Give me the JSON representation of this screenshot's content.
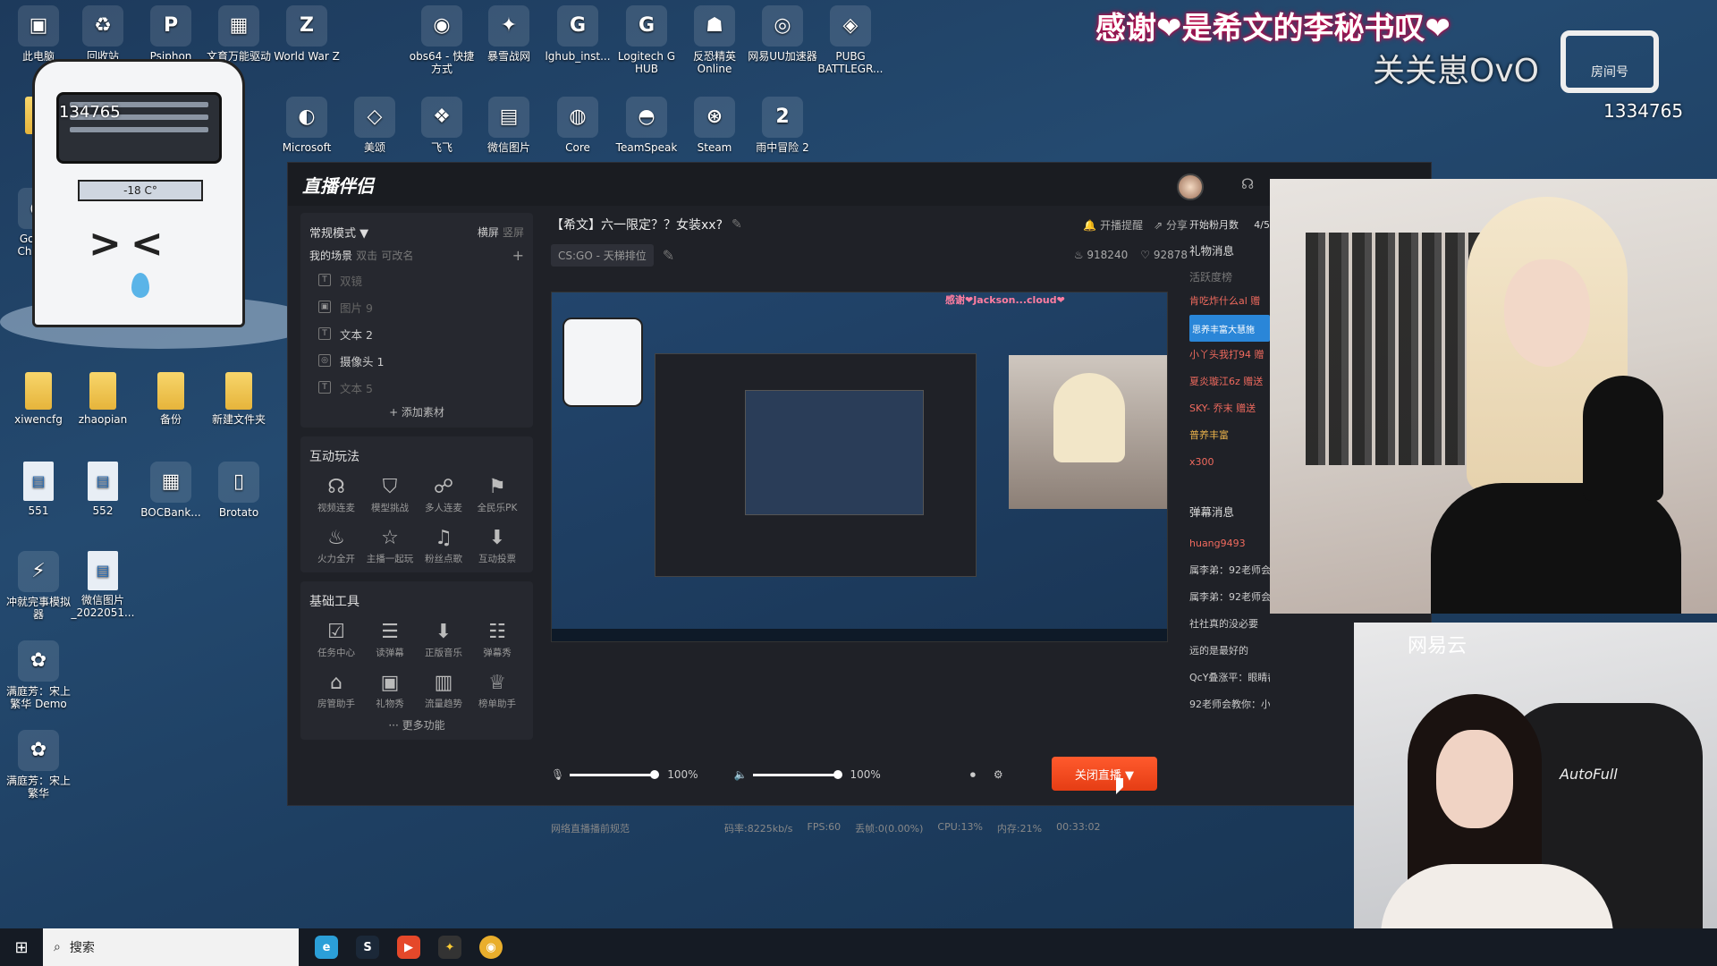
{
  "desktop": {
    "icons_row1": [
      {
        "label": "此电脑",
        "glyph": "▣"
      },
      {
        "label": "回收站",
        "glyph": "♻"
      },
      {
        "label": "Psiphon",
        "glyph": "P"
      },
      {
        "label": "文育万能驱动",
        "glyph": "▦"
      },
      {
        "label": "World War Z",
        "glyph": "Z"
      },
      {
        "label": "obs64 - 快捷方式",
        "glyph": "◉"
      },
      {
        "label": "暴雪战网",
        "glyph": "✦"
      },
      {
        "label": "lghub_inst...",
        "glyph": "G"
      },
      {
        "label": "Logitech G HUB",
        "glyph": "G"
      },
      {
        "label": "反恐精英 Online",
        "glyph": "☗"
      },
      {
        "label": "网易UU加速器",
        "glyph": "◎"
      },
      {
        "label": "PUBG BATTLEGR...",
        "glyph": "◈"
      }
    ],
    "icons_row2": [
      {
        "label": "调",
        "glyph": "▮"
      },
      {
        "label": "Microsoft",
        "glyph": "◐"
      },
      {
        "label": "美颂",
        "glyph": "◇"
      },
      {
        "label": "飞飞",
        "glyph": "❖"
      },
      {
        "label": "微信图片",
        "glyph": "▤"
      },
      {
        "label": "Core",
        "glyph": "◍"
      },
      {
        "label": "TeamSpeak",
        "glyph": "◓"
      },
      {
        "label": "Steam",
        "glyph": "⊛"
      },
      {
        "label": "雨中冒险 2",
        "glyph": "2"
      }
    ],
    "icons_left": [
      {
        "label": "Google Chrome",
        "glyph": "◉"
      },
      {
        "label": "xiwencfg",
        "glyph": ""
      },
      {
        "label": "zhaopian",
        "glyph": ""
      },
      {
        "label": "备份",
        "glyph": ""
      },
      {
        "label": "新建文件夹",
        "glyph": ""
      },
      {
        "label": "551",
        "glyph": "▤"
      },
      {
        "label": "552",
        "glyph": "▤"
      },
      {
        "label": "BOCBank...",
        "glyph": "▦"
      },
      {
        "label": "Brotato",
        "glyph": "▯"
      },
      {
        "label": "冲就完事模拟器",
        "glyph": "⚡"
      },
      {
        "label": "微信图片_2022051...",
        "glyph": "▤"
      },
      {
        "label": "满庭芳：宋上繁华 Demo",
        "glyph": "✿"
      },
      {
        "label": "满庭芳：宋上繁华",
        "glyph": "✿"
      }
    ]
  },
  "mascot": {
    "temperature": "-18 C°",
    "count": "134765"
  },
  "overlay": {
    "ticker": "感谢❤是希文的李秘书叹❤",
    "name": "关关崽OvO",
    "brand": "bili",
    "room_label": "房间号",
    "room_no": "1334765"
  },
  "app": {
    "logo": "直播伴侣",
    "mode_label": "常规模式 ▼",
    "orientation": [
      "横屏",
      "竖屏"
    ],
    "scene_tabs": [
      "我的场景",
      "双击",
      "可改名"
    ],
    "sources": [
      {
        "label": "双镜",
        "icon": "T",
        "dim": true
      },
      {
        "label": "图片 9",
        "icon": "▣",
        "dim": true
      },
      {
        "label": "文本 2",
        "icon": "T",
        "dim": false
      },
      {
        "label": "摄像头 1",
        "icon": "◎",
        "dim": false
      },
      {
        "label": "文本 5",
        "icon": "T",
        "dim": true
      }
    ],
    "add_source": "+ 添加素材",
    "interactive_title": "互动玩法",
    "interactive_tools": [
      {
        "label": "视频连麦",
        "glyph": "☊"
      },
      {
        "label": "模型挑战",
        "glyph": "⛉"
      },
      {
        "label": "多人连麦",
        "glyph": "☍"
      },
      {
        "label": "全民乐PK",
        "glyph": "⚑"
      },
      {
        "label": "火力全开",
        "glyph": "♨"
      },
      {
        "label": "主播一起玩",
        "glyph": "☆"
      },
      {
        "label": "粉丝点歌",
        "glyph": "♫"
      },
      {
        "label": "互动投票",
        "glyph": "⬇"
      }
    ],
    "basic_title": "基础工具",
    "basic_tools": [
      {
        "label": "任务中心",
        "glyph": "☑"
      },
      {
        "label": "读弹幕",
        "glyph": "☰"
      },
      {
        "label": "正版音乐",
        "glyph": "⬇"
      },
      {
        "label": "弹幕秀",
        "glyph": "☷"
      },
      {
        "label": "房管助手",
        "glyph": "⌂"
      },
      {
        "label": "礼物秀",
        "glyph": "▣"
      },
      {
        "label": "流量趋势",
        "glyph": "▥"
      },
      {
        "label": "榜单助手",
        "glyph": "♕"
      }
    ],
    "more_tools": "··· 更多功能",
    "stream_title": "【希文】六一限定？？女装xx?",
    "notify": "开播提醒",
    "share": "分享",
    "category": "CS:GO - 天梯排位",
    "popularity": "918240",
    "likes": "92878",
    "mic_volume": "100%",
    "speaker_volume": "100%",
    "end_button": "关闭直播 ▼",
    "status": {
      "rule": "网络直播播前规范",
      "bitrate": "码率:8225kb/s",
      "fps": "FPS:60",
      "drop": "丢帧:0(0.00%)",
      "cpu": "CPU:13%",
      "mem": "内存:21%",
      "time": "00:33:02"
    },
    "fans_label": "开始粉月数",
    "fans_value": "4/5",
    "gift_title": "礼物消息",
    "gift_sub": "活跃度榜",
    "gift_msgs": [
      "肯吃炸什么al 赠",
      "思养丰富大慧施",
      "小丫头我打94 赠",
      "夏炎璇江6z 赠送",
      "SKY- 乔末 赠送",
      "普养丰富",
      "x300"
    ],
    "danmu_title": "弹幕消息",
    "danmu_msgs": [
      "huang9493",
      "属李弟：92老师会教你：什么",
      "属李弟：92老师会教你：这",
      "社社真的没必要",
      "远的是最好的",
      "QcY叠涨平：眼睛都带参锅铃",
      "92老师会教你：小硬"
    ]
  },
  "cam": {
    "brand": "AutoFull",
    "tag": "网易云"
  },
  "taskbar": {
    "search_placeholder": "搜索"
  },
  "colors": {
    "accent": "#ff5a2d",
    "panel": "#1f2127",
    "desktop": "#244a70"
  }
}
